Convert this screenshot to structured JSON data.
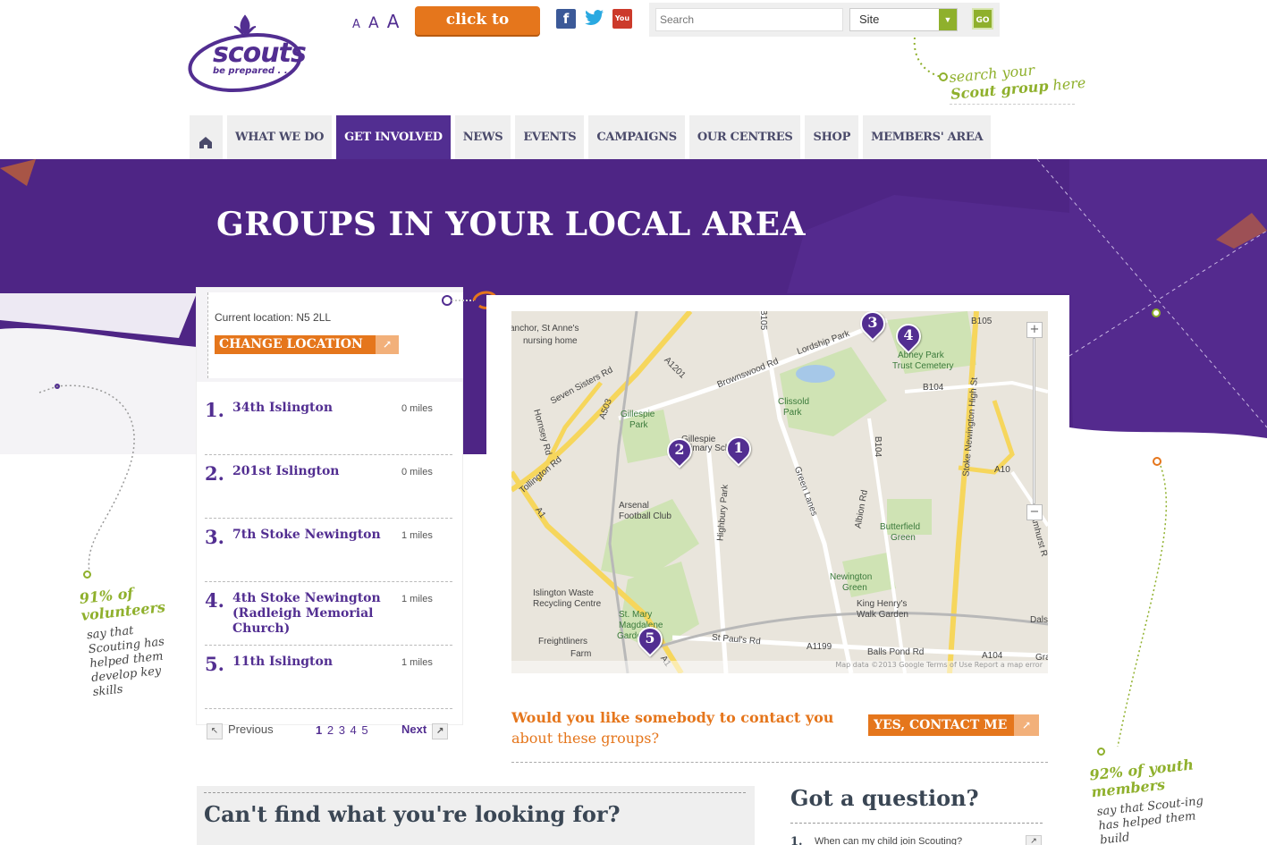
{
  "header": {
    "logo_text": "scouts",
    "logo_tagline": "be prepared . . .",
    "font_sizes": [
      "A",
      "A",
      "A"
    ],
    "donate_label": "click to donate",
    "social": [
      {
        "icon": "facebook-icon",
        "label": "f"
      },
      {
        "icon": "twitter-icon",
        "label": "🐦"
      },
      {
        "icon": "youtube-icon",
        "label": "You Tube"
      }
    ],
    "search_placeholder": "Search",
    "site_select_value": "Site",
    "go_label": "GO",
    "search_note_line1": "search your",
    "search_note_line2_bold": "Scout group",
    "search_note_line2_rest": " here"
  },
  "nav": {
    "items": [
      {
        "label": "WHAT WE DO",
        "active": false
      },
      {
        "label": "GET INVOLVED",
        "active": true
      },
      {
        "label": "NEWS",
        "active": false
      },
      {
        "label": "EVENTS",
        "active": false
      },
      {
        "label": "CAMPAIGNS",
        "active": false
      },
      {
        "label": "OUR CENTRES",
        "active": false
      },
      {
        "label": "SHOP",
        "active": false
      },
      {
        "label": "MEMBERS' AREA",
        "active": false
      }
    ]
  },
  "page_title": "GROUPS IN YOUR LOCAL AREA",
  "location": {
    "label": "Current location: N5 2LL",
    "change_label": "CHANGE LOCATION"
  },
  "results": [
    {
      "num": "1.",
      "name": "34th Islington",
      "distance": "0 miles"
    },
    {
      "num": "2.",
      "name": "201st Islington",
      "distance": "0 miles"
    },
    {
      "num": "3.",
      "name": "7th Stoke Newington",
      "distance": "1 miles"
    },
    {
      "num": "4.",
      "name": "4th Stoke Newington (Radleigh Memorial Church)",
      "distance": "1 miles"
    },
    {
      "num": "5.",
      "name": "11th Islington",
      "distance": "1 miles"
    }
  ],
  "pager": {
    "prev": "Previous",
    "current": "1",
    "pages": "2 3 4 5",
    "next": "Next"
  },
  "map": {
    "labels": [
      {
        "text": "anchor, St Anne's"
      },
      {
        "text": "nursing home"
      },
      {
        "text": "Seven Sisters Rd"
      },
      {
        "text": "A1201"
      },
      {
        "text": "Brownswood Rd"
      },
      {
        "text": "Lordship Park"
      },
      {
        "text": "Abney Park"
      },
      {
        "text": "Trust Cemetery"
      },
      {
        "text": "B104"
      },
      {
        "text": "Clissold"
      },
      {
        "text": "Park"
      },
      {
        "text": "Gillespie"
      },
      {
        "text": "Park"
      },
      {
        "text": "Gillespie"
      },
      {
        "text": "Primary School"
      },
      {
        "text": "Hornsey Rd"
      },
      {
        "text": "Tollington Rd"
      },
      {
        "text": "Arsenal"
      },
      {
        "text": "Football Club"
      },
      {
        "text": "Highbury Park"
      },
      {
        "text": "Green Lanes"
      },
      {
        "text": "Albion Rd"
      },
      {
        "text": "B104"
      },
      {
        "text": "Stoke Newington High St"
      },
      {
        "text": "A10"
      },
      {
        "text": "Butterfield"
      },
      {
        "text": "Green"
      },
      {
        "text": "Newington"
      },
      {
        "text": "Green"
      },
      {
        "text": "King Henry's"
      },
      {
        "text": "Walk Garden"
      },
      {
        "text": "Islington Waste"
      },
      {
        "text": "Recycling Centre"
      },
      {
        "text": "St. Mary"
      },
      {
        "text": "Magdalene"
      },
      {
        "text": "Gardens"
      },
      {
        "text": "Freightliners"
      },
      {
        "text": "Farm"
      },
      {
        "text": "St Paul's Rd"
      },
      {
        "text": "A1199"
      },
      {
        "text": "Balls Pond Rd"
      },
      {
        "text": "A104"
      },
      {
        "text": "Amhurst R"
      },
      {
        "text": "Dals"
      },
      {
        "text": "Grah"
      },
      {
        "text": "A503"
      },
      {
        "text": "B105"
      },
      {
        "text": "A1"
      },
      {
        "text": "A1"
      },
      {
        "text": "B105"
      }
    ],
    "markers": [
      "1",
      "2",
      "3",
      "4",
      "5"
    ],
    "zoom_in": "+",
    "zoom_out": "−",
    "footer": "Map data ©2013 Google   Terms of Use   Report a map error"
  },
  "contact": {
    "question_line1": "Would you like somebody to contact you",
    "question_line2": "about these groups?",
    "button_label": "YES, CONTACT ME"
  },
  "bottom": {
    "cant_find": "Can't find what you're looking for?",
    "got_question": "Got a question?",
    "faq1_num": "1.",
    "faq1": "When can my child join Scouting?"
  },
  "stats": {
    "left_big_line1": "91% of",
    "left_big_line2": "volunteers",
    "left_small": "say that Scouting has helped them develop key skills",
    "right_big_line1": "92% of youth",
    "right_big_line2": "members",
    "right_small": "say that Scout-ing has helped them build"
  },
  "colors": {
    "purple": "#522e91",
    "orange": "#e5761c",
    "green": "#8fb02c"
  }
}
